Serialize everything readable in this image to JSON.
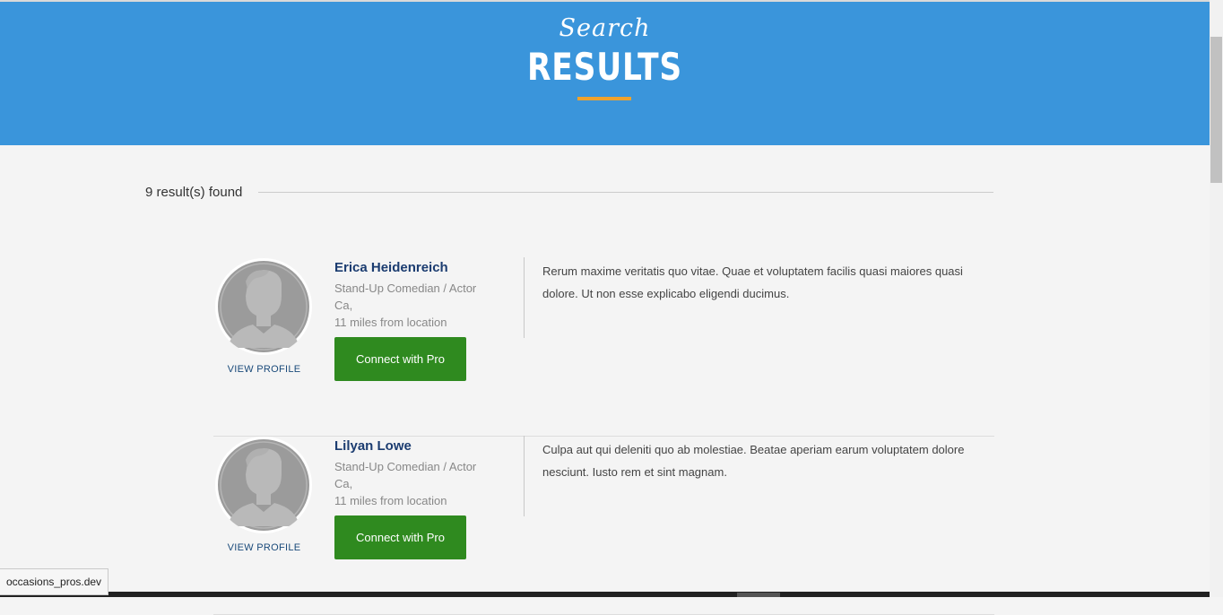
{
  "hero": {
    "script_text": "Search",
    "title": "RESULTS"
  },
  "results": {
    "count_text": "9 result(s) found"
  },
  "cards": [
    {
      "name": "Erica Heidenreich",
      "role": "Stand-Up Comedian / Actor",
      "location": "Ca,",
      "distance": "11 miles from location",
      "view_profile_label": "VIEW PROFILE",
      "connect_label": "Connect with Pro",
      "bio": "Rerum maxime veritatis quo vitae. Quae et voluptatem facilis quasi maiores quasi dolore. Ut non esse explicabo eligendi ducimus."
    },
    {
      "name": "Lilyan Lowe",
      "role": "Stand-Up Comedian / Actor",
      "location": "Ca,",
      "distance": "11 miles from location",
      "view_profile_label": "VIEW PROFILE",
      "connect_label": "Connect with Pro",
      "bio": "Culpa aut qui deleniti quo ab molestiae. Beatae aperiam earum voluptatem dolore nesciunt. Iusto rem et sint magnam."
    }
  ],
  "status_bar": {
    "url": "occasions_pros.dev"
  },
  "colors": {
    "hero_background": "#3a95db",
    "accent_underline": "#f0a22c",
    "connect_button": "#2f8a1f",
    "name_text": "#1b3c70"
  },
  "icons": {
    "avatar": "user-silhouette-icon"
  }
}
